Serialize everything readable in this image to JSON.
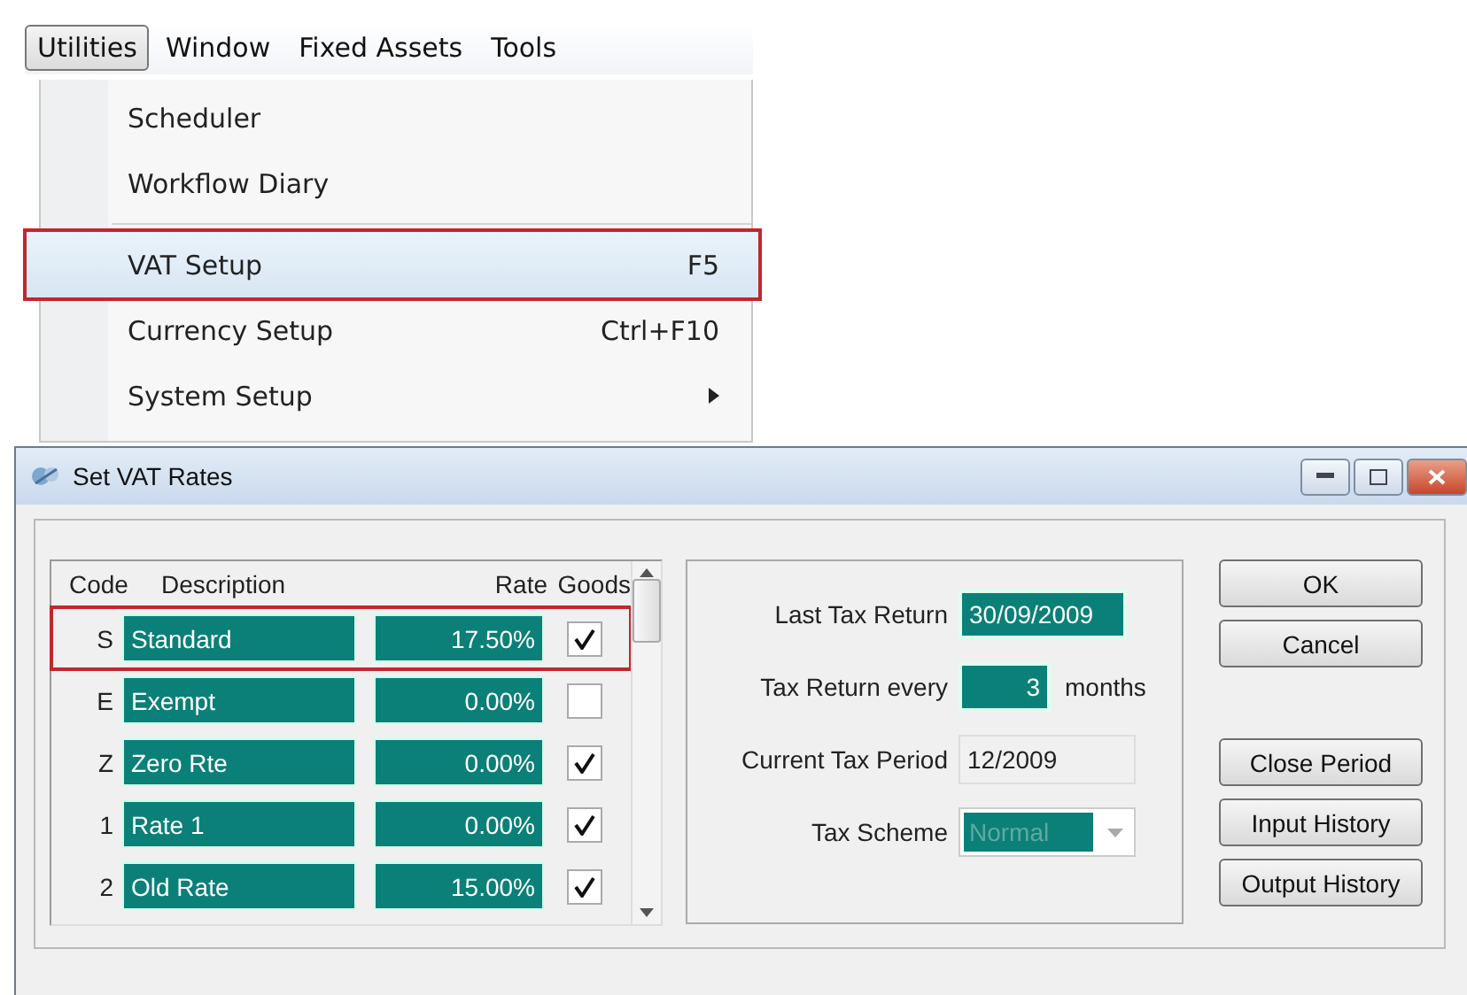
{
  "menu_bar": [
    {
      "label": "Utilities",
      "selected": true
    },
    {
      "label": "Window",
      "selected": false
    },
    {
      "label": "Fixed Assets",
      "selected": false
    },
    {
      "label": "Tools",
      "selected": false
    }
  ],
  "menu": {
    "items": [
      {
        "label": "Scheduler",
        "outlined": false,
        "submenu": false
      },
      {
        "label": "Workflow Diary",
        "outlined": false,
        "submenu": false,
        "separator_after": true
      },
      {
        "label": "VAT Setup",
        "shortcut": "F5",
        "outlined": true,
        "submenu": false
      },
      {
        "label": "Currency Setup",
        "shortcut": "Ctrl+F10",
        "outlined": false,
        "submenu": false
      },
      {
        "label": "System Setup",
        "outlined": false,
        "submenu": true
      }
    ]
  },
  "dialog": {
    "title": "Set VAT Rates",
    "table": {
      "columns": [
        "Code",
        "Description",
        "Rate",
        "Goods"
      ],
      "rows": [
        {
          "code": "S",
          "description": "Standard",
          "rate": "17.50%",
          "goods": true,
          "outlined": true
        },
        {
          "code": "E",
          "description": "Exempt",
          "rate": "0.00%",
          "goods": false,
          "outlined": false
        },
        {
          "code": "Z",
          "description": "Zero Rte",
          "rate": "0.00%",
          "goods": true,
          "outlined": false
        },
        {
          "code": "1",
          "description": "Rate 1",
          "rate": "0.00%",
          "goods": true,
          "outlined": false
        },
        {
          "code": "2",
          "description": "Old Rate",
          "rate": "15.00%",
          "goods": true,
          "outlined": false
        }
      ]
    },
    "fields": {
      "last_tax_return": {
        "label": "Last Tax Return",
        "value": "30/09/2009"
      },
      "tax_return_every": {
        "label": "Tax Return every",
        "value": "3",
        "unit": "months"
      },
      "current_tax_period": {
        "label": "Current Tax Period",
        "value": "12/2009"
      },
      "tax_scheme": {
        "label": "Tax Scheme",
        "value": "Normal",
        "disabled": true
      }
    },
    "buttons": [
      "OK",
      "Cancel"
    ],
    "side_buttons": [
      "Close Period",
      "Input History",
      "Output History"
    ]
  }
}
